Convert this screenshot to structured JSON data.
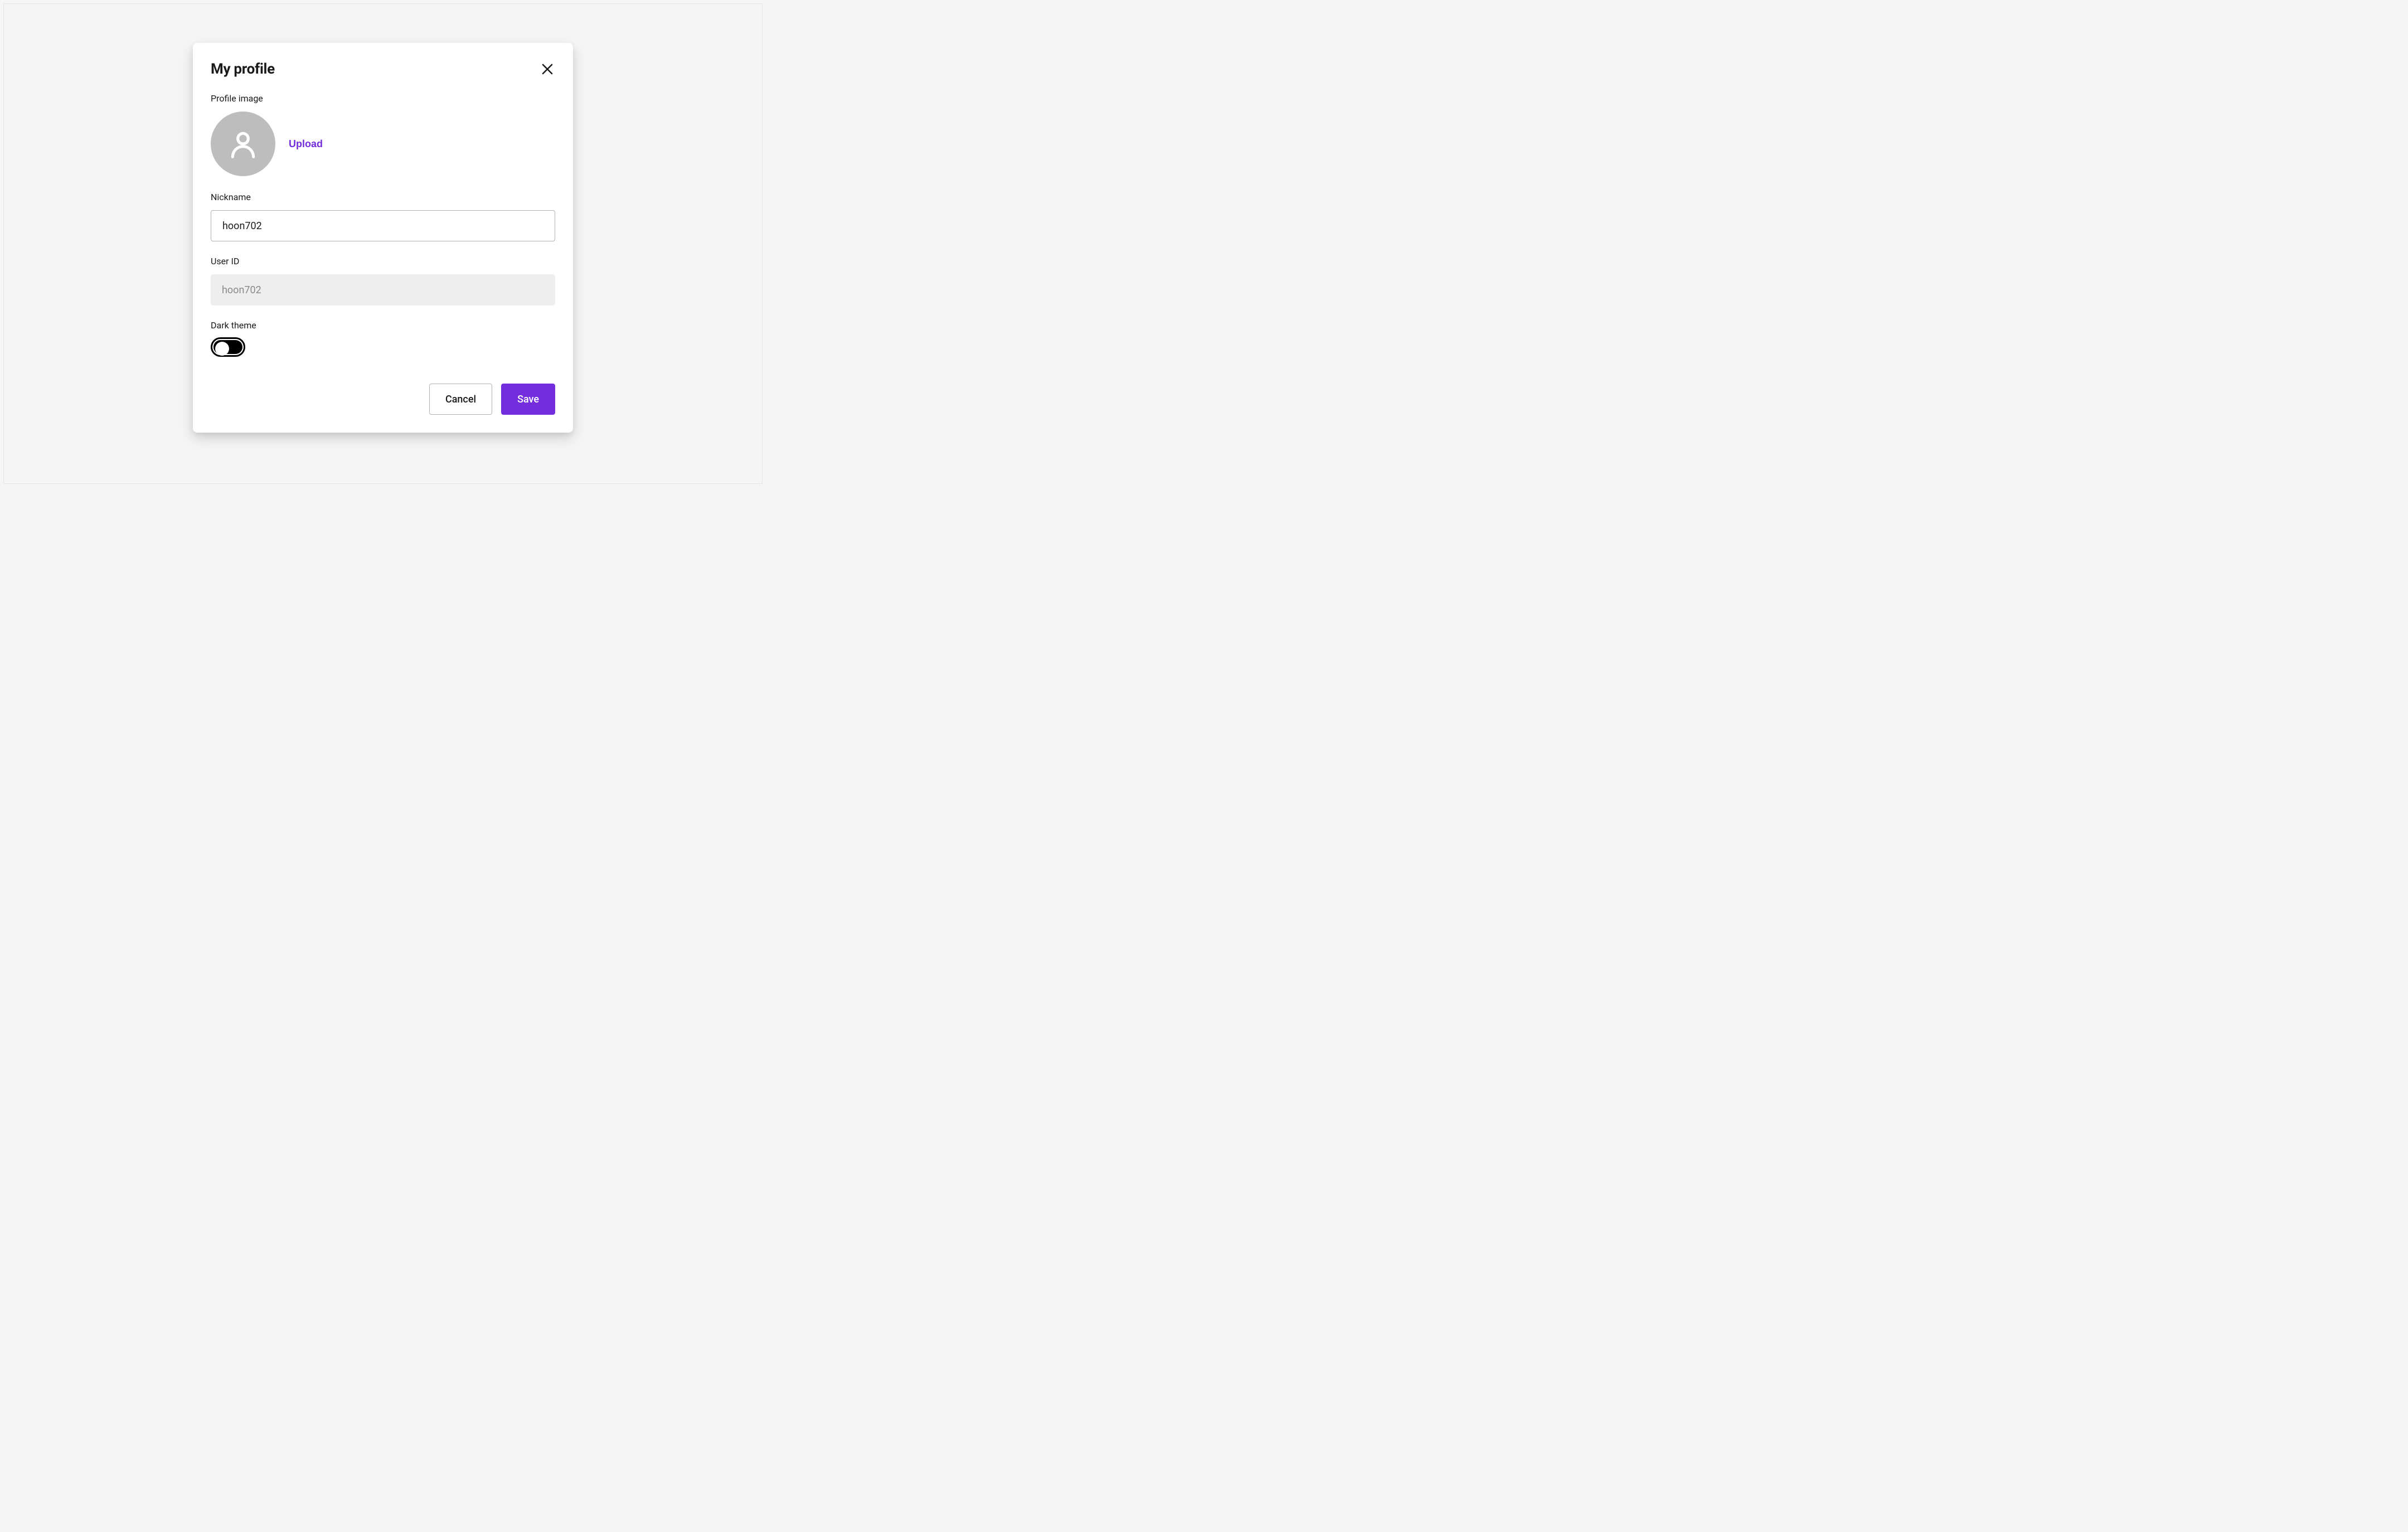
{
  "modal": {
    "title": "My profile",
    "sections": {
      "profile_image": {
        "label": "Profile image",
        "upload_label": "Upload"
      },
      "nickname": {
        "label": "Nickname",
        "value": "hoon702"
      },
      "user_id": {
        "label": "User ID",
        "value": "hoon702"
      },
      "dark_theme": {
        "label": "Dark theme",
        "enabled": false
      }
    },
    "actions": {
      "cancel_label": "Cancel",
      "save_label": "Save"
    }
  },
  "colors": {
    "accent": "#742ddd"
  }
}
